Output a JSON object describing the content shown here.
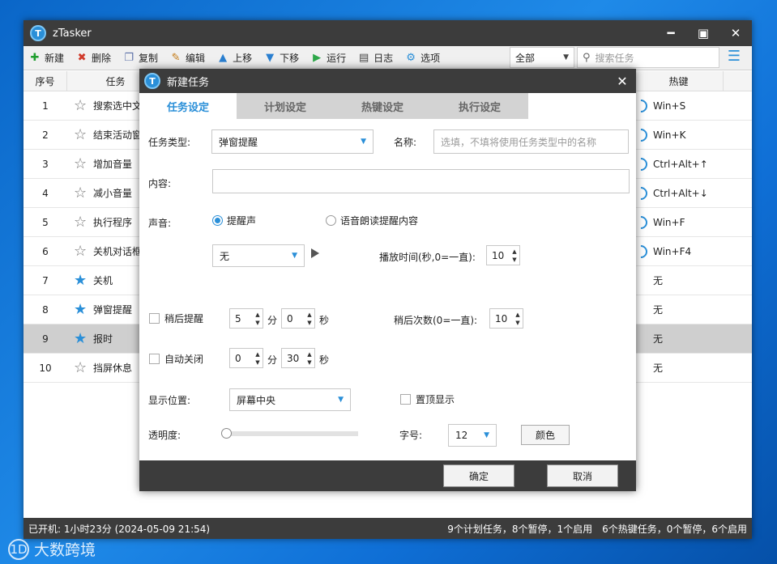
{
  "app": {
    "title": "zTasker",
    "logo_letter": "T"
  },
  "window_controls": {
    "minimize": "━",
    "maximize": "▣",
    "close": "✕"
  },
  "toolbar": {
    "items": [
      {
        "label": "新建",
        "icon": "plus-icon",
        "glyph": "✚",
        "color": "#1e9e2e"
      },
      {
        "label": "删除",
        "icon": "delete-icon",
        "glyph": "✖",
        "color": "#d03a2a"
      },
      {
        "label": "复制",
        "icon": "copy-icon",
        "glyph": "❐",
        "color": "#5a6fa8"
      },
      {
        "label": "编辑",
        "icon": "edit-icon",
        "glyph": "✎",
        "color": "#c47a14"
      },
      {
        "label": "上移",
        "icon": "arrow-up-icon",
        "glyph": "▲",
        "color": "#2a7fd0"
      },
      {
        "label": "下移",
        "icon": "arrow-down-icon",
        "glyph": "▼",
        "color": "#2a7fd0"
      },
      {
        "label": "运行",
        "icon": "play-icon",
        "glyph": "▶",
        "color": "#2ea84a"
      },
      {
        "label": "日志",
        "icon": "log-icon",
        "glyph": "▤",
        "color": "#444"
      },
      {
        "label": "选项",
        "icon": "gear-icon",
        "glyph": "⚙",
        "color": "#2a8fd8"
      }
    ],
    "filter": "全部",
    "search_placeholder": "搜索任务"
  },
  "table": {
    "headers": [
      "序号",
      "任务",
      "热键"
    ],
    "rows": [
      {
        "num": "1",
        "task": "搜索选中文",
        "fav": false,
        "toggle": true,
        "hotkey": "Win+S"
      },
      {
        "num": "2",
        "task": "结束活动窗",
        "fav": false,
        "toggle": true,
        "hotkey": "Win+K"
      },
      {
        "num": "3",
        "task": "增加音量",
        "fav": false,
        "toggle": true,
        "hotkey": "Ctrl+Alt+↑"
      },
      {
        "num": "4",
        "task": "减小音量",
        "fav": false,
        "toggle": true,
        "hotkey": "Ctrl+Alt+↓"
      },
      {
        "num": "5",
        "task": "执行程序",
        "fav": false,
        "toggle": true,
        "hotkey": "Win+F"
      },
      {
        "num": "6",
        "task": "关机对话框",
        "fav": false,
        "toggle": true,
        "hotkey": "Win+F4"
      },
      {
        "num": "7",
        "task": "关机",
        "fav": true,
        "toggle": false,
        "hotkey": "无"
      },
      {
        "num": "8",
        "task": "弹窗提醒",
        "fav": true,
        "toggle": false,
        "hotkey": "无"
      },
      {
        "num": "9",
        "task": "报时",
        "fav": true,
        "toggle": false,
        "hotkey": "无",
        "selected": true
      },
      {
        "num": "10",
        "task": "挡屏休息",
        "fav": false,
        "toggle": false,
        "hotkey": "无"
      }
    ]
  },
  "status": {
    "left": "已开机: 1小时23分 (2024-05-09 21:54)",
    "right": "9个计划任务，8个暂停，1个启用　6个热键任务，0个暂停，6个启用"
  },
  "dialog": {
    "title": "新建任务",
    "tabs": [
      "任务设定",
      "计划设定",
      "热键设定",
      "执行设定"
    ],
    "task_type_label": "任务类型:",
    "task_type_value": "弹窗提醒",
    "name_label": "名称:",
    "name_placeholder": "选填，不填将使用任务类型中的名称",
    "content_label": "内容:",
    "sound_label": "声音:",
    "sound_opt1": "提醒声",
    "sound_opt2": "语音朗读提醒内容",
    "sound_select": "无",
    "play_time_label": "播放时间(秒,0=一直):",
    "play_time_value": "10",
    "snooze_label": "稍后提醒",
    "snooze_min": "5",
    "min_unit": "分",
    "snooze_sec": "0",
    "sec_unit": "秒",
    "snooze_count_label": "稍后次数(0=一直):",
    "snooze_count_value": "10",
    "autoclose_label": "自动关闭",
    "autoclose_min": "0",
    "autoclose_sec": "30",
    "position_label": "显示位置:",
    "position_value": "屏幕中央",
    "ontop_label": "置顶显示",
    "opacity_label": "透明度:",
    "opacity_value": 0,
    "fontsize_label": "字号:",
    "fontsize_value": "12",
    "color_button": "颜色",
    "ok_button": "确定",
    "cancel_button": "取消"
  },
  "watermark": {
    "logo": "1D",
    "text": "大数跨境"
  }
}
